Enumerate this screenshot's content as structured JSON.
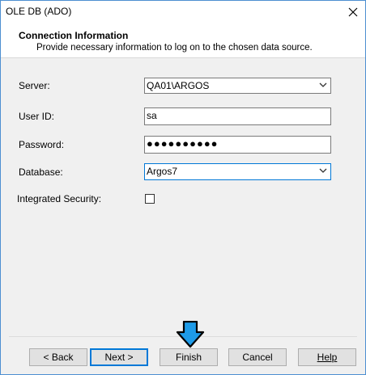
{
  "window": {
    "title": "OLE DB (ADO)",
    "close_icon": "close-icon"
  },
  "header": {
    "title": "Connection Information",
    "subtitle": "Provide necessary information to log on to the chosen data source."
  },
  "form": {
    "server_label": "Server:",
    "server_value": "QA01\\ARGOS",
    "userid_label": "User ID:",
    "userid_value": "sa",
    "password_label": "Password:",
    "password_value": "●●●●●●●●●●",
    "database_label": "Database:",
    "database_value": "Argos7",
    "integrated_label": "Integrated Security:",
    "integrated_checked": false
  },
  "buttons": {
    "back": "< Back",
    "next": "Next >",
    "finish": "Finish",
    "cancel": "Cancel",
    "help": "Help"
  },
  "colors": {
    "accent": "#0078d7",
    "arrow_fill": "#1e9be8",
    "arrow_stroke": "#000000"
  }
}
